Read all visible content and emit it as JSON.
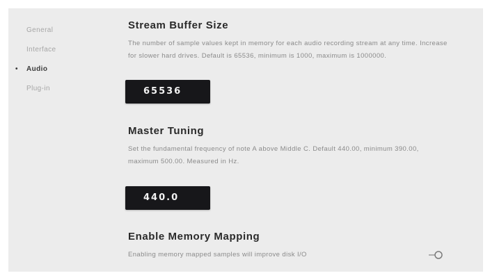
{
  "nav": {
    "items": [
      {
        "label": "General",
        "active": false
      },
      {
        "label": "Interface",
        "active": false
      },
      {
        "label": "Audio",
        "active": true
      },
      {
        "label": "Plug-in",
        "active": false
      }
    ],
    "active_marker": "•"
  },
  "settings": {
    "stream_buffer": {
      "title": "Stream Buffer Size",
      "description": "The number of sample values kept in memory for each audio recording stream at any time. Increase for slower hard drives. Default is 65536, minimum is 1000, maximum is 1000000.",
      "value": "65536"
    },
    "master_tuning": {
      "title": "Master Tuning",
      "description": "Set the fundamental frequency of note A above Middle C. Default 440.00, minimum 390.00, maximum 500.00. Measured in Hz.",
      "value": "440.0"
    },
    "memory_mapping": {
      "title": "Enable Memory Mapping",
      "description": "Enabling memory mapped samples will improve disk I/O",
      "enabled": false
    }
  },
  "colors": {
    "panel_bg": "#ececec",
    "value_box_bg": "#17171a",
    "value_text": "#f2f2f2",
    "heading": "#2a2a2a",
    "muted_text": "#8a8a8a"
  },
  "icons": {
    "toggle": "toggle-switch-off-icon"
  }
}
